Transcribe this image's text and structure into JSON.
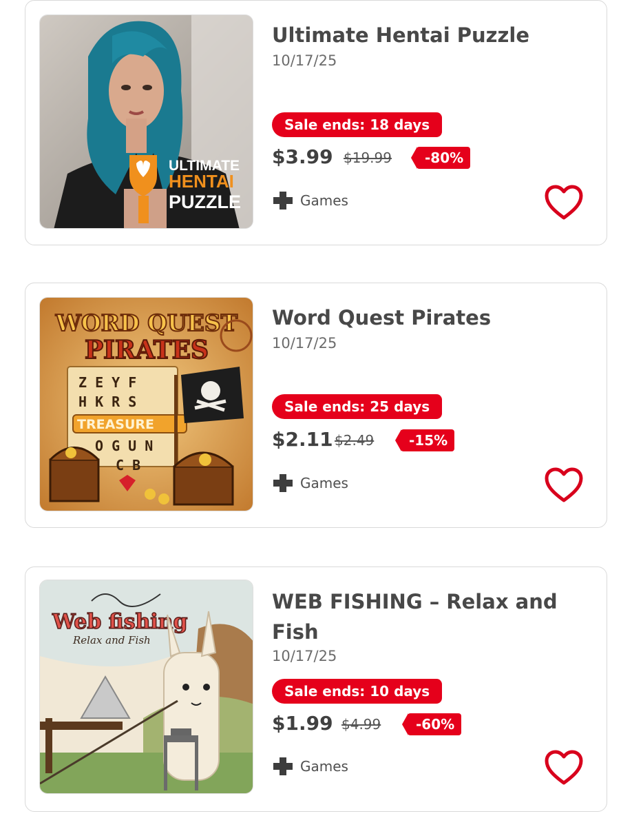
{
  "products": [
    {
      "title": "Ultimate Hentai Puzzle",
      "date": "10/17/25",
      "sale": "Sale ends: 18 days",
      "price": "$3.99",
      "original_price": "$19.99",
      "discount": "-80%",
      "category": "Games",
      "category_icon": "plus-icon",
      "image_text": [
        "ULTIMATE",
        "HENTAI",
        "PUZZLE"
      ]
    },
    {
      "title": "Word Quest Pirates",
      "date": "10/17/25",
      "sale": "Sale ends: 25 days",
      "price": "$2.11",
      "original_price": "$2.49",
      "discount": "-15%",
      "category": "Games",
      "category_icon": "plus-icon",
      "image_text": [
        "WORD QUEST",
        "PIRATES",
        "Z E Y F",
        "H K R S",
        "TREASURE",
        "O G U N",
        "C B"
      ]
    },
    {
      "title": "WEB FISHING – Relax and Fish",
      "date": "10/17/25",
      "sale": "Sale ends: 10 days",
      "price": "$1.99",
      "original_price": "$4.99",
      "discount": "-60%",
      "category": "Games",
      "category_icon": "plus-icon",
      "image_text": [
        "Web fishing",
        "Relax and Fish"
      ]
    }
  ],
  "colors": {
    "sale_red": "#e5001b",
    "text_dark": "#484848",
    "border": "#d9d9d9"
  },
  "icons": {
    "favorite": "heart-icon",
    "category": "plus-icon"
  }
}
